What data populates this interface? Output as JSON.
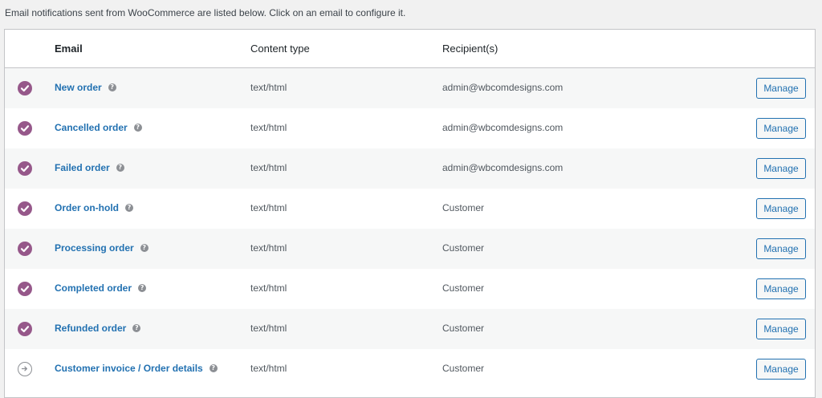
{
  "intro_text": "Email notifications sent from WooCommerce are listed below. Click on an email to configure it.",
  "headers": {
    "email": "Email",
    "content_type": "Content type",
    "recipients": "Recipient(s)"
  },
  "colors": {
    "enabled_status": "#96588a",
    "link": "#2271b1"
  },
  "rows": [
    {
      "name": "New order",
      "status": "enabled",
      "content_type": "text/html",
      "recipient": "admin@wbcomdesigns.com",
      "action": "Manage"
    },
    {
      "name": "Cancelled order",
      "status": "enabled",
      "content_type": "text/html",
      "recipient": "admin@wbcomdesigns.com",
      "action": "Manage"
    },
    {
      "name": "Failed order",
      "status": "enabled",
      "content_type": "text/html",
      "recipient": "admin@wbcomdesigns.com",
      "action": "Manage"
    },
    {
      "name": "Order on-hold",
      "status": "enabled",
      "content_type": "text/html",
      "recipient": "Customer",
      "action": "Manage"
    },
    {
      "name": "Processing order",
      "status": "enabled",
      "content_type": "text/html",
      "recipient": "Customer",
      "action": "Manage"
    },
    {
      "name": "Completed order",
      "status": "enabled",
      "content_type": "text/html",
      "recipient": "Customer",
      "action": "Manage"
    },
    {
      "name": "Refunded order",
      "status": "enabled",
      "content_type": "text/html",
      "recipient": "Customer",
      "action": "Manage"
    },
    {
      "name": "Customer invoice / Order details",
      "status": "manual",
      "content_type": "text/html",
      "recipient": "Customer",
      "action": "Manage"
    }
  ]
}
